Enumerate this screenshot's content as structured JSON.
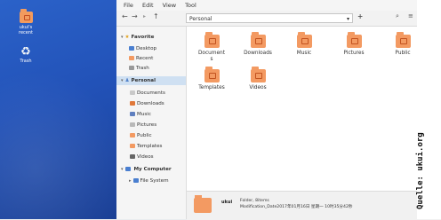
{
  "desktop": {
    "icons": [
      {
        "label": "ukui's\nrecent"
      },
      {
        "label": "Trash"
      }
    ]
  },
  "menubar": {
    "items": [
      "File",
      "Edit",
      "View",
      "Tool"
    ]
  },
  "toolbar": {
    "path": "Personal",
    "icons": [
      "back-arrow",
      "forward-arrow",
      "history-arrow",
      "up-arrow",
      "add-tab",
      "search",
      "list-view",
      "grid-view"
    ]
  },
  "sidebar": {
    "favorite_header": "Favorite",
    "favorites": [
      "Desktop",
      "Recent",
      "Trash"
    ],
    "personal_header": "Personal",
    "personal_items": [
      "Documents",
      "Downloads",
      "Music",
      "Pictures",
      "Public",
      "Templates",
      "Videos"
    ],
    "computer_header": "My Computer",
    "computer_items": [
      "File System"
    ]
  },
  "content": {
    "items": [
      "Document\ns",
      "Downloads",
      "Music",
      "Pictures",
      "Public",
      "Templates",
      "Videos"
    ]
  },
  "status": {
    "name": "ukui",
    "line1": "Folder, 8items",
    "line2": "Modification_Date2017年01月16日 星期一 10时35分42秒"
  },
  "credit": "Quelle: ukui.org",
  "colors": {
    "folder": "#f39a62",
    "desktop": "#2b62c9",
    "selection": "#cfe0f2"
  }
}
